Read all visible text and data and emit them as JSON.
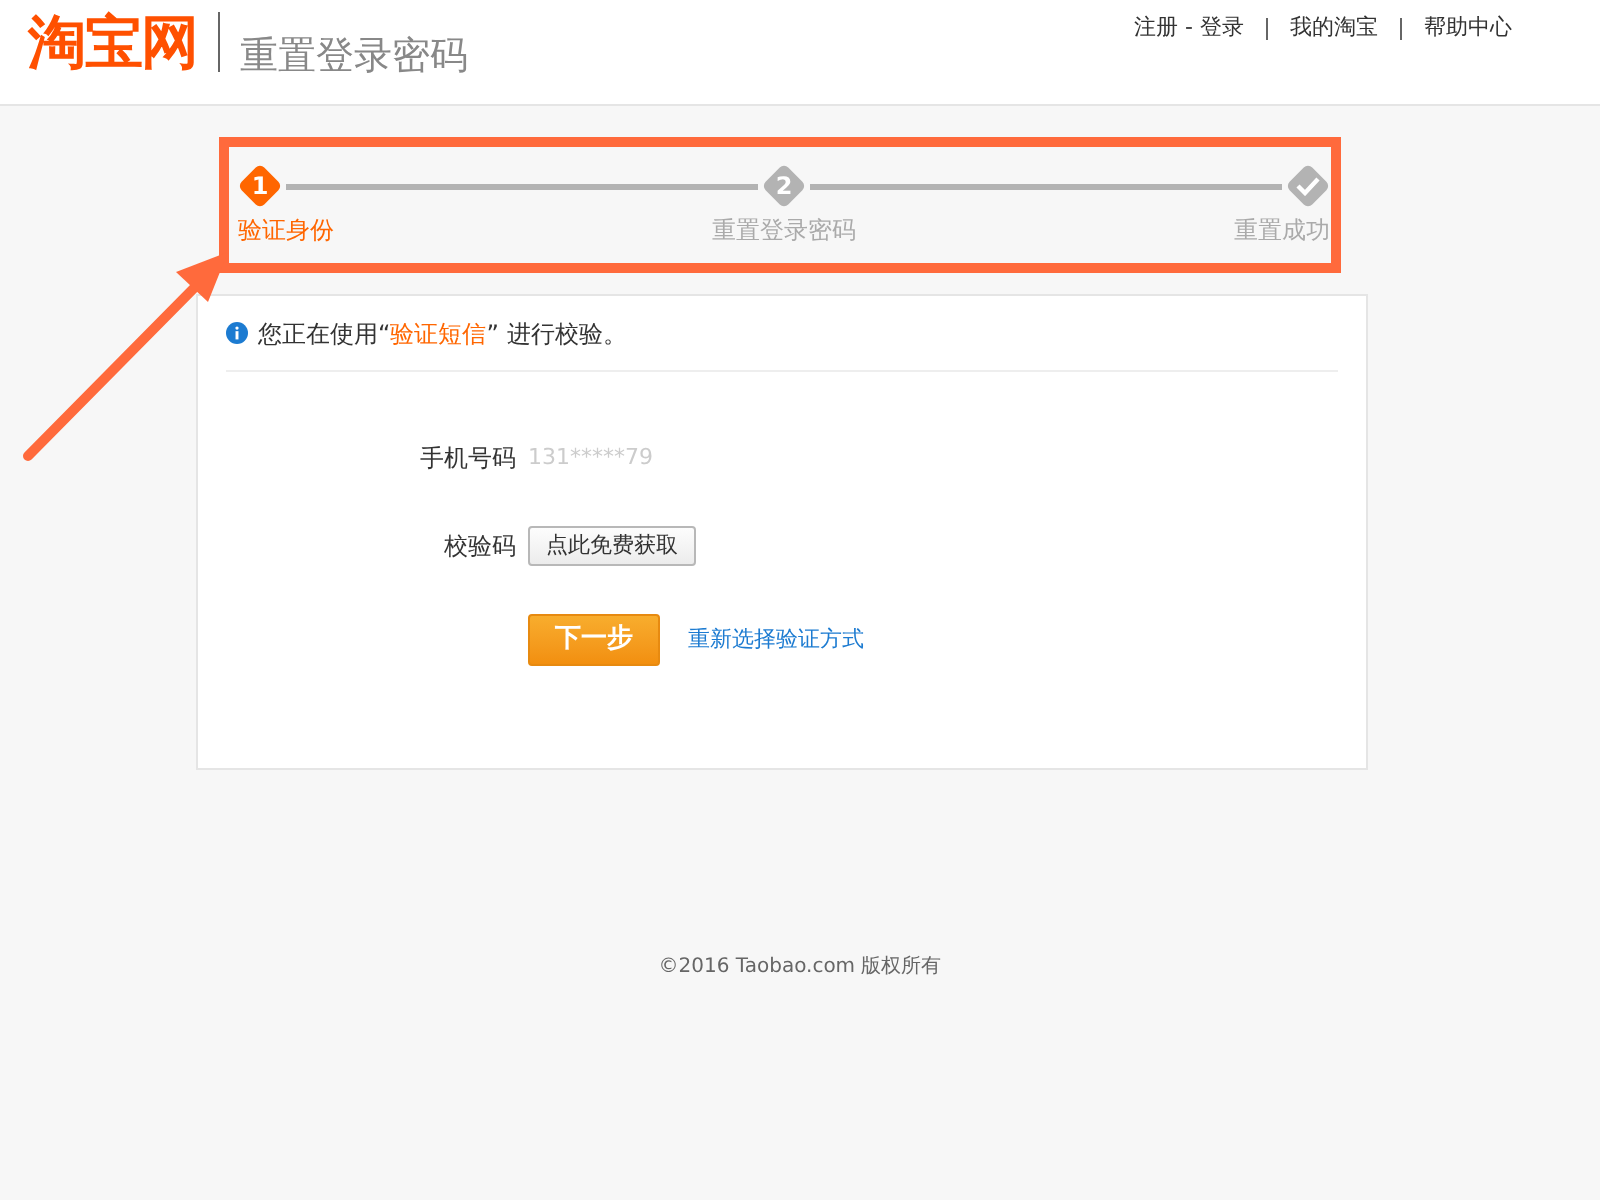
{
  "header": {
    "logo": "淘宝网",
    "title": "重置登录密码",
    "links": [
      "注册 - 登录",
      "我的淘宝",
      "帮助中心"
    ]
  },
  "steps": [
    {
      "kind": "number",
      "marker": "1",
      "label": "验证身份",
      "selected": true
    },
    {
      "kind": "number",
      "marker": "2",
      "label": "重置登录密码",
      "selected": false
    },
    {
      "kind": "check",
      "label": "重置成功",
      "selected": false
    }
  ],
  "notice": {
    "before": "您正在使用“",
    "highlight": "验证短信",
    "after": "” 进行校验。"
  },
  "form": {
    "phone_label": "手机号码",
    "phone": "131*****79",
    "code_label": "校验码",
    "code_button": "点此免费获取",
    "next_button": "下一步",
    "switch_link": "重新选择验证方式"
  },
  "footer": "©2016 Taobao.com 版权所有",
  "annotation": {
    "kind": "box-arrow"
  }
}
